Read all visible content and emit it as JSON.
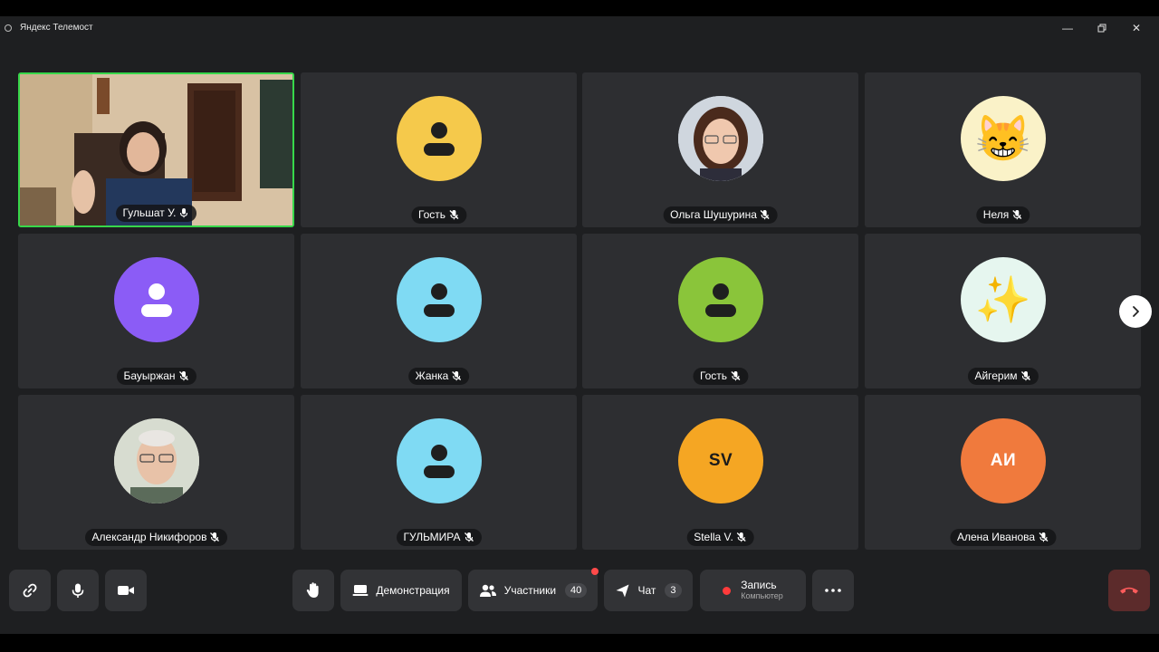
{
  "window": {
    "title": "Яндекс Телемост"
  },
  "participants": [
    {
      "name": "Гульшат У.",
      "type": "video"
    },
    {
      "name": "Гость",
      "type": "icon",
      "color": "#f5c94b"
    },
    {
      "name": "Ольга Шушурина",
      "type": "photo"
    },
    {
      "name": "Неля",
      "type": "emoji",
      "emoji": "😸",
      "color": "#faf2c8"
    },
    {
      "name": "Бауыржан",
      "type": "icon",
      "color": "#8b5cf6"
    },
    {
      "name": "Жанка",
      "type": "icon",
      "color": "#7fdaf3"
    },
    {
      "name": "Гость",
      "type": "icon",
      "color": "#8ac53a"
    },
    {
      "name": "Айгерим",
      "type": "emoji",
      "emoji": "✨",
      "color": "#e6f6ef"
    },
    {
      "name": "Александр Никифоров",
      "type": "photo"
    },
    {
      "name": "ГУЛЬМИРА",
      "type": "icon",
      "color": "#7fdaf3"
    },
    {
      "name": "Stella V.",
      "type": "initials",
      "initials": "SV",
      "color": "#f5a623"
    },
    {
      "name": "Алена Иванова",
      "type": "initials",
      "initials": "АИ",
      "color": "#f07a3d"
    }
  ],
  "toolbar": {
    "demo_label": "Демонстрация",
    "participants_label": "Участники",
    "participants_count": "40",
    "chat_label": "Чат",
    "chat_count": "3",
    "record_label": "Запись",
    "record_sub": "Компьютер"
  },
  "colors": {
    "active_border": "#37d74a",
    "record": "#ff3b3b",
    "leave_bg": "#5c2b2b"
  }
}
